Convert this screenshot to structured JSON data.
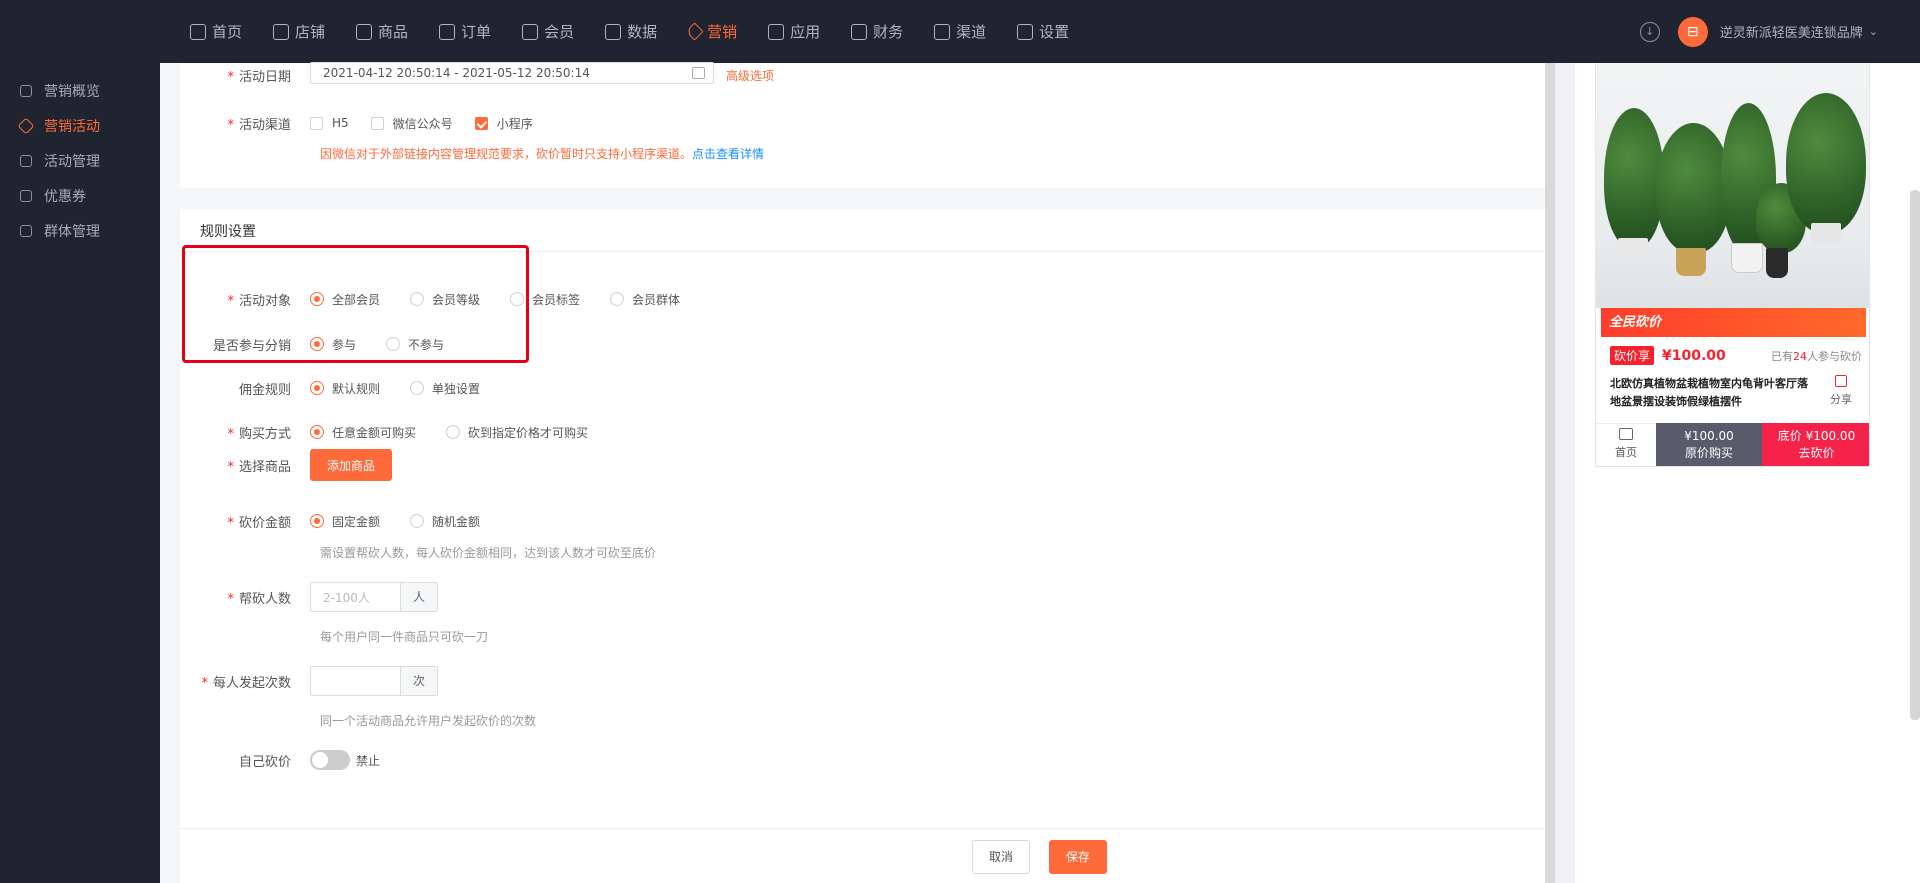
{
  "topnav": {
    "items": [
      {
        "label": "首页",
        "icon": "home-icon"
      },
      {
        "label": "店铺",
        "icon": "store-icon"
      },
      {
        "label": "商品",
        "icon": "goods-icon"
      },
      {
        "label": "订单",
        "icon": "order-icon"
      },
      {
        "label": "会员",
        "icon": "member-icon"
      },
      {
        "label": "数据",
        "icon": "chart-icon"
      },
      {
        "label": "营销",
        "icon": "tag-icon",
        "active": true
      },
      {
        "label": "应用",
        "icon": "app-icon"
      },
      {
        "label": "财务",
        "icon": "finance-icon"
      },
      {
        "label": "渠道",
        "icon": "channel-icon"
      },
      {
        "label": "设置",
        "icon": "gear-icon"
      }
    ],
    "store_name": "逆灵新派轻医美连锁品牌",
    "store_logo_glyph": "⊟"
  },
  "sidebar": {
    "items": [
      {
        "label": "营销概览"
      },
      {
        "label": "营销活动",
        "active": true
      },
      {
        "label": "活动管理"
      },
      {
        "label": "优惠券"
      },
      {
        "label": "群体管理"
      }
    ]
  },
  "basic": {
    "date_label": "活动日期",
    "date_value": "2021-04-12 20:50:14 - 2021-05-12 20:50:14",
    "advanced_link": "高级选项",
    "channel_label": "活动渠道",
    "channels": [
      {
        "label": "H5",
        "checked": false
      },
      {
        "label": "微信公众号",
        "checked": false
      },
      {
        "label": "小程序",
        "checked": true
      }
    ],
    "warning": "因微信对于外部链接内容管理规范要求，砍价暂时只支持小程序渠道。",
    "warning_link": "点击查看详情"
  },
  "rules": {
    "section_title": "规则设置",
    "target_label": "活动对象",
    "target_options": [
      "全部会员",
      "会员等级",
      "会员标签",
      "会员群体"
    ],
    "distribution_label": "是否参与分销",
    "distribution_options": [
      "参与",
      "不参与"
    ],
    "commission_label": "佣金规则",
    "commission_options": [
      "默认规则",
      "单独设置"
    ],
    "purchase_label": "购买方式",
    "purchase_options": [
      "任意金额可购买",
      "砍到指定价格才可购买"
    ],
    "product_label": "选择商品",
    "add_product_button": "添加商品",
    "amount_label": "砍价金额",
    "amount_options": [
      "固定金额",
      "随机金额"
    ],
    "amount_hint": "需设置帮砍人数，每人砍价金额相同，达到该人数才可砍至底价",
    "helpers_label": "帮砍人数",
    "helpers_placeholder": "2-100人",
    "helpers_unit": "人",
    "helpers_hint": "每个用户同一件商品只可砍一刀",
    "launches_label": "每人发起次数",
    "launches_placeholder": "",
    "launches_unit": "次",
    "launches_hint": "同一个活动商品允许用户发起砍价的次数",
    "self_label": "自己砍价",
    "self_status": "禁止"
  },
  "footer": {
    "cancel": "取消",
    "save": "保存"
  },
  "preview": {
    "promo_banner": "全民砍价",
    "tag": "砍价享",
    "price": "¥100.00",
    "joined_prefix": "已有",
    "joined_count": "24",
    "joined_suffix": "人参与砍价",
    "product_title_line1": "北欧仿真植物盆栽植物室内龟背叶客厅落",
    "product_title_line2": "地盆景摆设装饰假绿植摆件",
    "share": "分享",
    "home": "首页",
    "orig_price": "¥100.00",
    "orig_buy": "原价购买",
    "floor_price": "底价 ¥100.00",
    "go_bargain": "去砍价"
  },
  "colors": {
    "accent": "#ff6a3a",
    "nav_bg": "#1f2430",
    "highlight_box": "#e60012",
    "price_red": "#f5222d"
  }
}
